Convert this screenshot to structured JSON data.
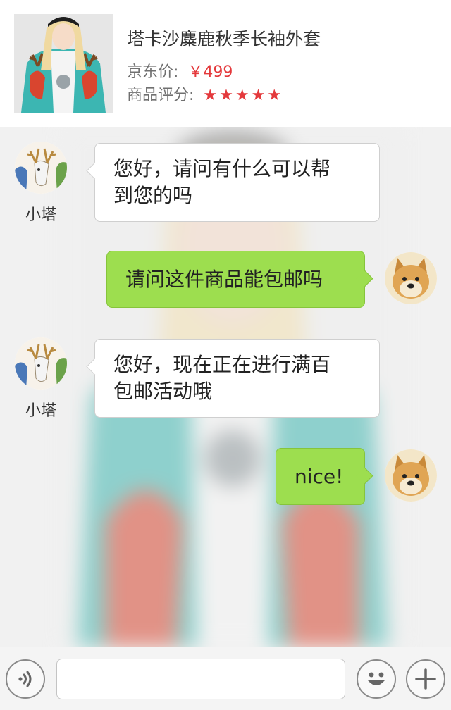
{
  "product": {
    "title": "塔卡沙麋鹿秋季长袖外套",
    "price_label": "京东价:",
    "price_value": "￥499",
    "rating_label": "商品评分:",
    "rating": 5,
    "rating_max": 5,
    "rating_stars": "★★★★★",
    "accent_color": "#e4393c"
  },
  "chat": {
    "messages": [
      {
        "from": "agent",
        "sender_name": "小塔",
        "line1": "您好，请问有什么可以帮",
        "line2": "到您的吗"
      },
      {
        "from": "user",
        "line1": "请问这件商品能包邮吗"
      },
      {
        "from": "agent",
        "sender_name": "小塔",
        "line1": "您好，现在正在进行满百",
        "line2": "包邮活动哦"
      },
      {
        "from": "user",
        "line1": "nice!"
      }
    ],
    "incoming_bubble_color": "#ffffff",
    "outgoing_bubble_color": "#9dde4f"
  },
  "input_bar": {
    "voice_icon": "voice-icon",
    "emoji_icon": "emoji-icon",
    "plus_icon": "plus-icon",
    "placeholder": ""
  }
}
